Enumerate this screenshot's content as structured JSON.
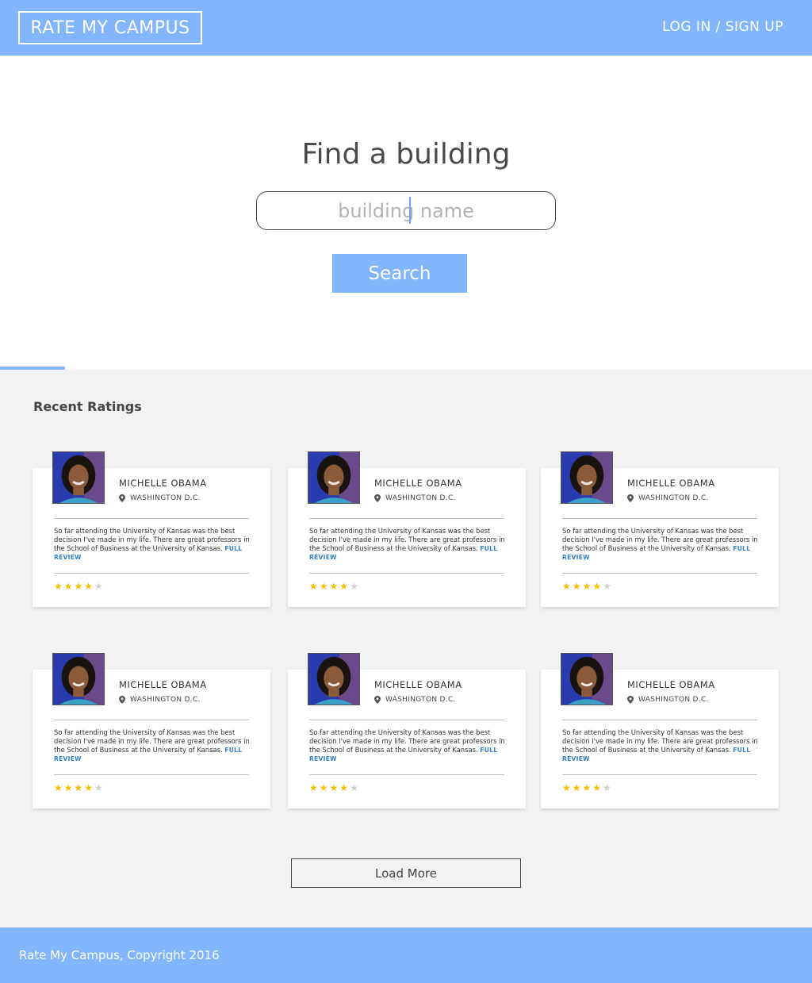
{
  "header": {
    "logo": "RATE MY CAMPUS",
    "login_link": "LOG IN / SIGN UP"
  },
  "hero": {
    "title": "Find a building",
    "search_placeholder": "building name",
    "search_button": "Search"
  },
  "ratings": {
    "section_title": "Recent Ratings",
    "cards": [
      {
        "name": "MICHELLE OBAMA",
        "location": "WASHINGTON D.C.",
        "text": "So far attending the University of Kansas was the best decision I've made in my life. There are great professors in the School of Business at the University of Kansas.",
        "link": "FULL REVIEW",
        "rating": 4,
        "max_rating": 5
      },
      {
        "name": "MICHELLE OBAMA",
        "location": "WASHINGTON D.C.",
        "text": "So far attending the University of Kansas was the best decision I've made in my life. There are great professors in the School of Business at the University of Kansas.",
        "link": "FULL REVIEW",
        "rating": 4,
        "max_rating": 5
      },
      {
        "name": "MICHELLE OBAMA",
        "location": "WASHINGTON D.C.",
        "text": "So far attending the University of Kansas was the best decision I've made in my life. There are great professors in the School of Business at the University of Kansas.",
        "link": "FULL REVIEW",
        "rating": 4,
        "max_rating": 5
      },
      {
        "name": "MICHELLE OBAMA",
        "location": "WASHINGTON D.C.",
        "text": "So far attending the University of Kansas was the best decision I've made in my life. There are great professors in the School of Business at the University of Kansas.",
        "link": "FULL REVIEW",
        "rating": 4,
        "max_rating": 5
      },
      {
        "name": "MICHELLE OBAMA",
        "location": "WASHINGTON D.C.",
        "text": "So far attending the University of Kansas was the best decision I've made in my life. There are great professors in the School of Business at the University of Kansas.",
        "link": "FULL REVIEW",
        "rating": 4,
        "max_rating": 5
      },
      {
        "name": "MICHELLE OBAMA",
        "location": "WASHINGTON D.C.",
        "text": "So far attending the University of Kansas was the best decision I've made in my life. There are great professors in the School of Business at the University of Kansas.",
        "link": "FULL REVIEW",
        "rating": 4,
        "max_rating": 5
      }
    ],
    "load_more": "Load More"
  },
  "footer": {
    "copyright": "Rate My Campus, Copyright 2016"
  },
  "colors": {
    "brand": "#82b5fb",
    "star": "#f5c000",
    "star_empty": "#cfcfcf",
    "link": "#2f80c9"
  }
}
